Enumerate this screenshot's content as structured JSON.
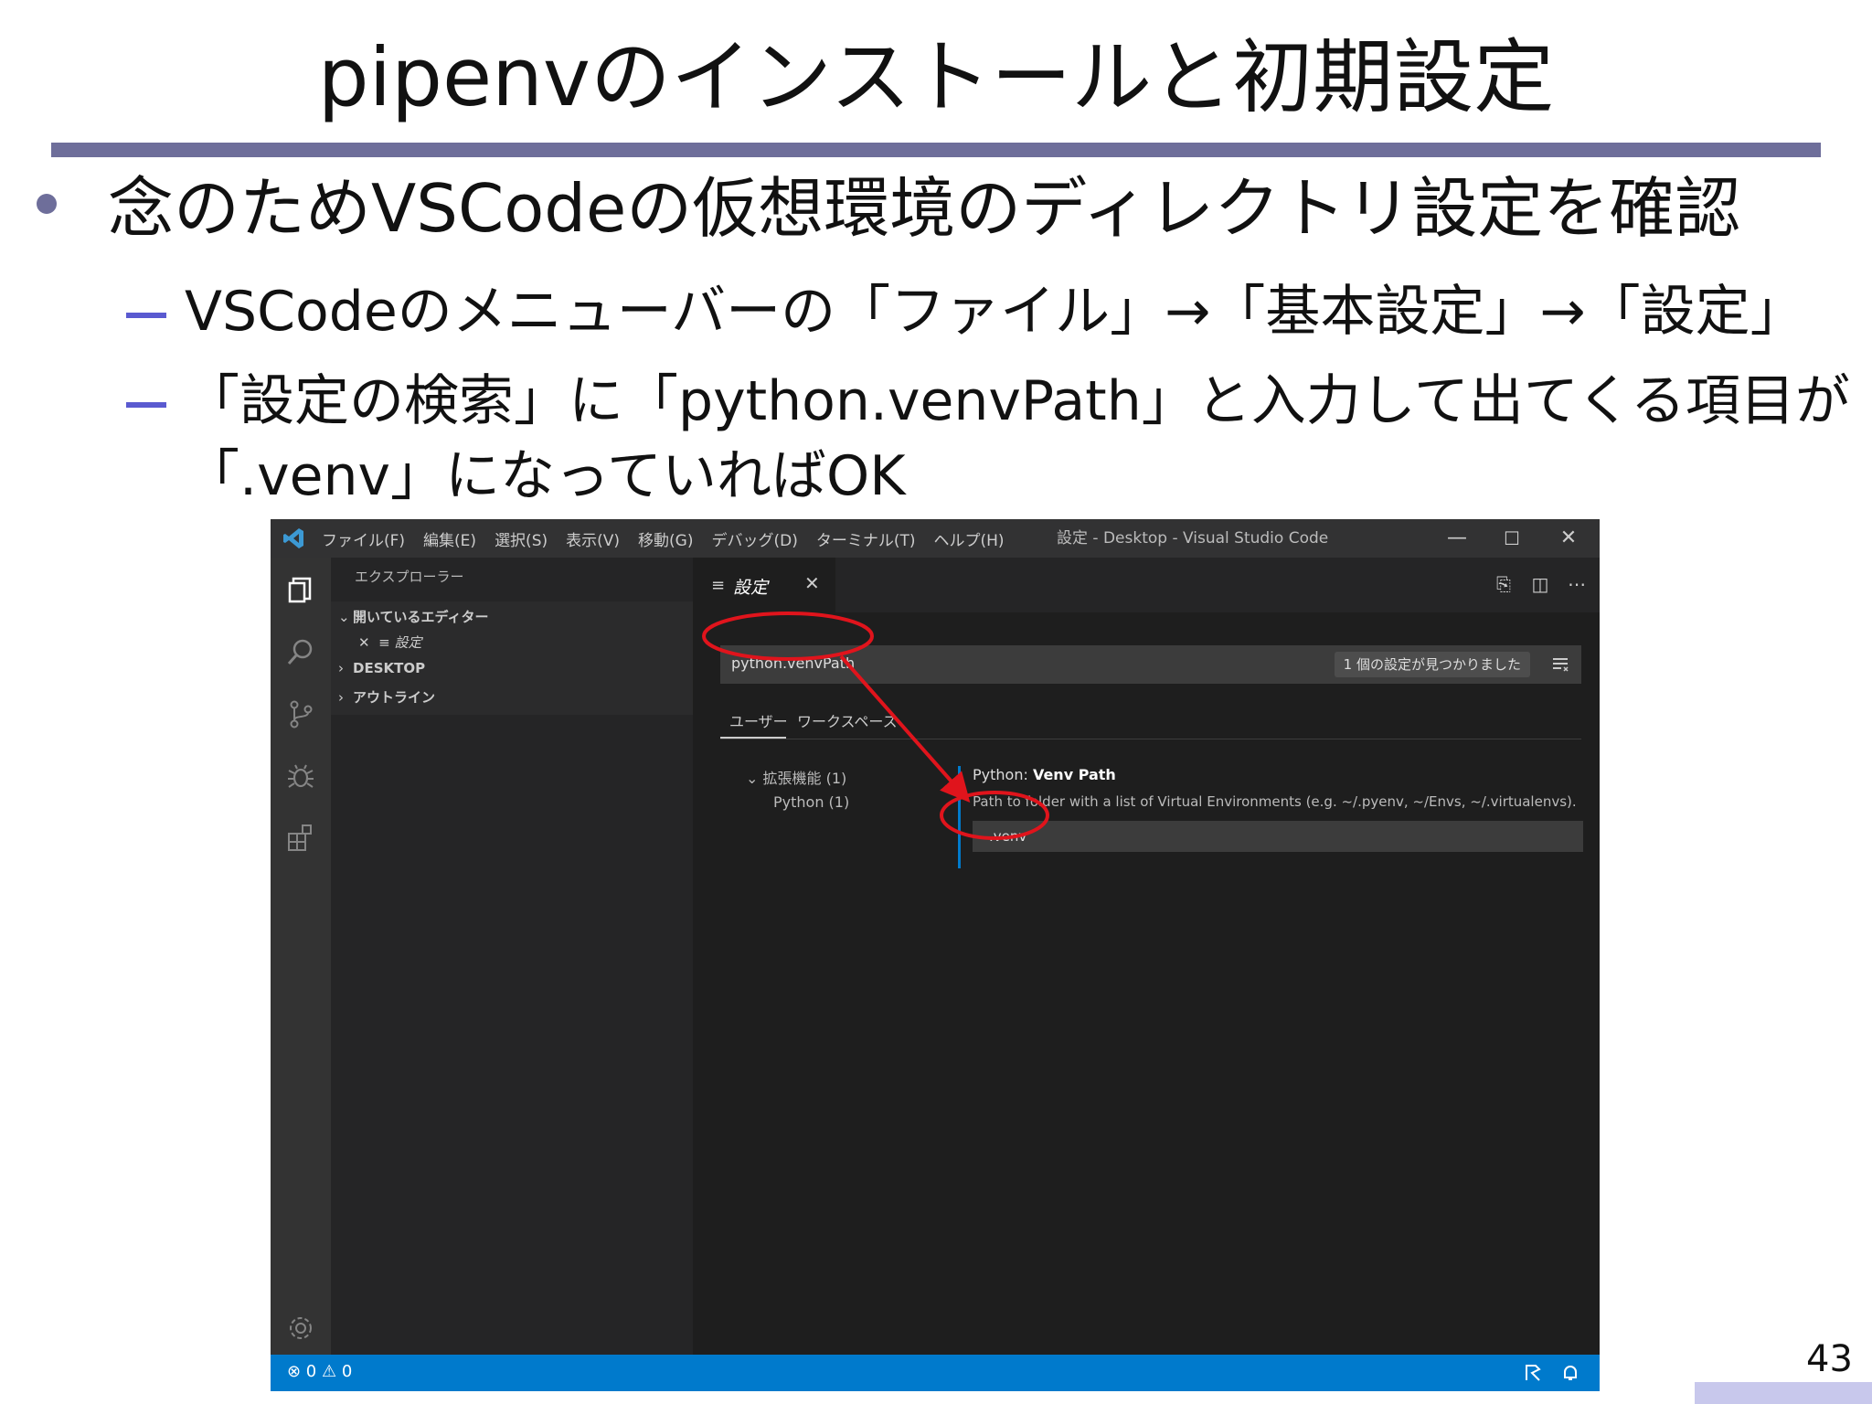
{
  "slide": {
    "title": "pipenvのインストールと初期設定",
    "bullet": "念のためVSCodeの仮想環境のディレクトリ設定を確認",
    "sub1": "VSCodeのメニューバーの「ファイル」→「基本設定」→「設定」",
    "sub2_line1": "「設定の検索」に「python.venvPath」と入力して出てくる項目が",
    "sub2_line2": "「.venv」になっていればOK",
    "page_number": "43"
  },
  "vscode": {
    "menu": [
      "ファイル(F)",
      "編集(E)",
      "選択(S)",
      "表示(V)",
      "移動(G)",
      "デバッグ(D)",
      "ターミナル(T)",
      "ヘルプ(H)"
    ],
    "window_title": "設定 - Desktop - Visual Studio Code",
    "window_controls": {
      "minimize": "—",
      "maximize": "☐",
      "close": "✕"
    },
    "sidebar": {
      "title": "エクスプローラー",
      "open_editors": "開いているエディター",
      "open_file": "設定",
      "desktop": "DESKTOP",
      "outline": "アウトライン"
    },
    "tab": {
      "label": "設定"
    },
    "search": {
      "value": "python.venvPath",
      "result_count": "1 個の設定が見つかりました"
    },
    "scopes": {
      "user": "ユーザー",
      "workspace": "ワークスペース"
    },
    "toc": {
      "extensions": "拡張機能 (1)",
      "python": "Python (1)"
    },
    "setting": {
      "title_prefix": "Python: ",
      "title_name": "Venv Path",
      "description": "Path to folder with a list of Virtual Environments (e.g. ~/.pyenv, ~/Envs, ~/.virtualenvs).",
      "value": ".venv"
    },
    "status": {
      "problems": "⊗ 0 ⚠ 0"
    },
    "colors": {
      "accent": "#007acc",
      "annotation": "#e0141c"
    }
  }
}
